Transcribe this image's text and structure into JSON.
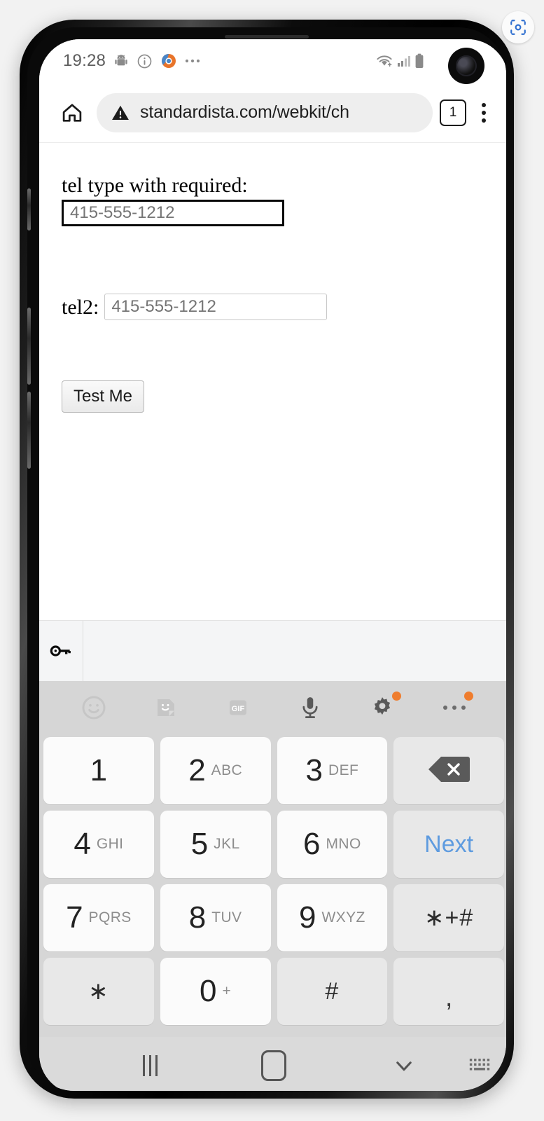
{
  "overlay": {
    "capture_icon": "screenshot-capture-icon"
  },
  "status_bar": {
    "clock": "19:28",
    "icons": [
      "android-robot-icon",
      "info-circle-icon",
      "chrome-app-icon",
      "more-status-icons"
    ],
    "right_icons": [
      "wifi-icon",
      "cellular-signal-icon",
      "battery-icon"
    ]
  },
  "browser": {
    "home_icon": "home-icon",
    "security_icon": "not-secure-warning-icon",
    "url": "standardista.com/webkit/ch",
    "tab_count": "1",
    "menu_icon": "overflow-menu-icon"
  },
  "page": {
    "tel1_label": "tel type with required:",
    "tel1_placeholder": "415-555-1212",
    "tel1_value": "",
    "tel2_label": "tel2:",
    "tel2_placeholder": "415-555-1212",
    "tel2_value": "",
    "submit_label": "Test Me"
  },
  "autofill_bar": {
    "key_icon": "password-key-icon"
  },
  "keyboard": {
    "toolbar": [
      {
        "name": "emoji-icon",
        "badge": false
      },
      {
        "name": "sticker-icon",
        "badge": false
      },
      {
        "name": "gif-icon",
        "badge": false,
        "label": "GIF"
      },
      {
        "name": "microphone-icon",
        "badge": false
      },
      {
        "name": "settings-gear-icon",
        "badge": true
      },
      {
        "name": "more-options-icon",
        "badge": true
      }
    ],
    "badge_color": "#ef7d2e",
    "next_key_color": "#5e9bdf",
    "rows": [
      [
        {
          "type": "num",
          "digit": "1",
          "letters": "",
          "name": "key-1"
        },
        {
          "type": "num",
          "digit": "2",
          "letters": "ABC",
          "name": "key-2"
        },
        {
          "type": "num",
          "digit": "3",
          "letters": "DEF",
          "name": "key-3"
        },
        {
          "type": "fn",
          "icon": "backspace-icon",
          "name": "key-backspace"
        }
      ],
      [
        {
          "type": "num",
          "digit": "4",
          "letters": "GHI",
          "name": "key-4"
        },
        {
          "type": "num",
          "digit": "5",
          "letters": "JKL",
          "name": "key-5"
        },
        {
          "type": "num",
          "digit": "6",
          "letters": "MNO",
          "name": "key-6"
        },
        {
          "type": "fn",
          "text": "Next",
          "style": "next",
          "name": "key-next"
        }
      ],
      [
        {
          "type": "num",
          "digit": "7",
          "letters": "PQRS",
          "name": "key-7"
        },
        {
          "type": "num",
          "digit": "8",
          "letters": "TUV",
          "name": "key-8"
        },
        {
          "type": "num",
          "digit": "9",
          "letters": "WXYZ",
          "name": "key-9"
        },
        {
          "type": "fn",
          "text": "∗+#",
          "style": "sym",
          "name": "key-symbols"
        }
      ],
      [
        {
          "type": "fn",
          "text": "∗",
          "style": "sym",
          "name": "key-asterisk"
        },
        {
          "type": "num",
          "digit": "0",
          "letters": "+",
          "name": "key-0"
        },
        {
          "type": "fn",
          "text": "#",
          "style": "sym",
          "name": "key-hash"
        },
        {
          "type": "fn",
          "text": ",",
          "style": "comma",
          "name": "key-comma"
        }
      ]
    ]
  },
  "nav_bar": {
    "recents": "recents-icon",
    "home": "home-nav-icon",
    "back": "hide-keyboard-chevron-icon",
    "kb_switch": "keyboard-switch-icon"
  }
}
